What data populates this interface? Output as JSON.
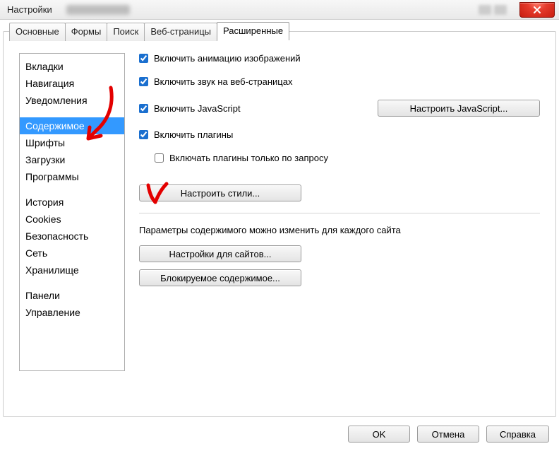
{
  "window": {
    "title": "Настройки"
  },
  "tabs": [
    {
      "label": "Основные"
    },
    {
      "label": "Формы"
    },
    {
      "label": "Поиск"
    },
    {
      "label": "Веб-страницы"
    },
    {
      "label": "Расширенные",
      "active": true
    }
  ],
  "categories_group1": [
    {
      "label": "Вкладки"
    },
    {
      "label": "Навигация"
    },
    {
      "label": "Уведомления"
    }
  ],
  "categories_group2": [
    {
      "label": "Содержимое",
      "selected": true
    },
    {
      "label": "Шрифты"
    },
    {
      "label": "Загрузки"
    },
    {
      "label": "Программы"
    }
  ],
  "categories_group3": [
    {
      "label": "История"
    },
    {
      "label": "Cookies"
    },
    {
      "label": "Безопасность"
    },
    {
      "label": "Сеть"
    },
    {
      "label": "Хранилище"
    }
  ],
  "categories_group4": [
    {
      "label": "Панели"
    },
    {
      "label": "Управление"
    }
  ],
  "content": {
    "enable_image_animation": "Включить анимацию изображений",
    "enable_sound": "Включить звук на веб-страницах",
    "enable_js": "Включить JavaScript",
    "configure_js": "Настроить JavaScript...",
    "enable_plugins": "Включить плагины",
    "plugins_on_demand": "Включать плагины только по запросу",
    "configure_styles": "Настроить стили...",
    "per_site_text": "Параметры содержимого можно изменить для каждого сайта",
    "site_settings": "Настройки для сайтов...",
    "blocked_content": "Блокируемое содержимое..."
  },
  "footer": {
    "ok": "OK",
    "cancel": "Отмена",
    "help": "Справка"
  }
}
